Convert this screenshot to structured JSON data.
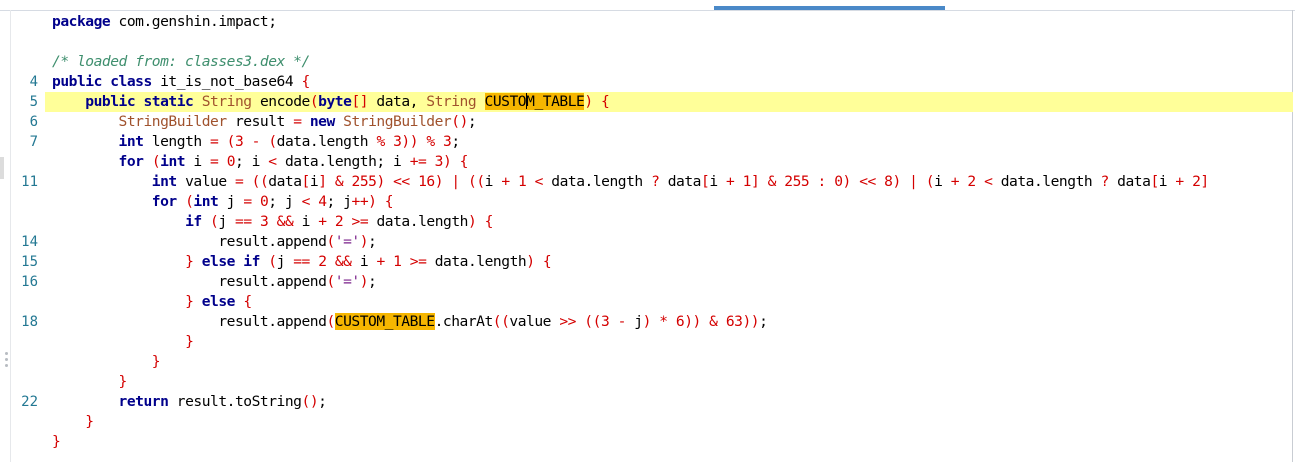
{
  "editor": {
    "lines": [
      {
        "num": "",
        "tokens": [
          [
            "kw",
            "package"
          ],
          [
            "pl",
            " com.genshin.impact;"
          ]
        ]
      },
      {
        "num": "",
        "tokens": []
      },
      {
        "num": "",
        "tokens": [
          [
            "cm",
            "/* loaded from: classes3.dex */"
          ]
        ]
      },
      {
        "num": "4",
        "tokens": [
          [
            "kw",
            "public class"
          ],
          [
            "pl",
            " it_is_not_base64 "
          ],
          [
            "pu",
            "{"
          ]
        ]
      },
      {
        "num": "5",
        "highlight": true,
        "tokens": [
          [
            "pl",
            "    "
          ],
          [
            "kw",
            "public static"
          ],
          [
            "pl",
            " "
          ],
          [
            "ty",
            "String"
          ],
          [
            "pl",
            " encode"
          ],
          [
            "pu",
            "("
          ],
          [
            "kw",
            "byte"
          ],
          [
            "pu",
            "[]"
          ],
          [
            "pl",
            " data, "
          ],
          [
            "ty",
            "String"
          ],
          [
            "pl",
            " "
          ],
          [
            "hl",
            "CUSTOM_TABLE",
            "caret",
            5
          ],
          [
            "pu",
            ")"
          ],
          [
            "pl",
            " "
          ],
          [
            "pu",
            "{"
          ]
        ]
      },
      {
        "num": "6",
        "tokens": [
          [
            "pl",
            "        "
          ],
          [
            "ty",
            "StringBuilder"
          ],
          [
            "pl",
            " result "
          ],
          [
            "pu",
            "="
          ],
          [
            "pl",
            " "
          ],
          [
            "kw",
            "new"
          ],
          [
            "pl",
            " "
          ],
          [
            "ty",
            "StringBuilder"
          ],
          [
            "pu",
            "()"
          ],
          [
            "pl",
            ";"
          ]
        ]
      },
      {
        "num": "7",
        "tokens": [
          [
            "pl",
            "        "
          ],
          [
            "kw",
            "int"
          ],
          [
            "pl",
            " length "
          ],
          [
            "pu",
            "="
          ],
          [
            "pl",
            " "
          ],
          [
            "pu",
            "("
          ],
          [
            "nu",
            "3"
          ],
          [
            "pl",
            " "
          ],
          [
            "pu",
            "-"
          ],
          [
            "pl",
            " "
          ],
          [
            "pu",
            "("
          ],
          [
            "pl",
            "data.length "
          ],
          [
            "pu",
            "%"
          ],
          [
            "pl",
            " "
          ],
          [
            "nu",
            "3"
          ],
          [
            "pu",
            "))"
          ],
          [
            "pl",
            " "
          ],
          [
            "pu",
            "%"
          ],
          [
            "pl",
            " "
          ],
          [
            "nu",
            "3"
          ],
          [
            "pl",
            ";"
          ]
        ]
      },
      {
        "num": "",
        "tokens": [
          [
            "pl",
            "        "
          ],
          [
            "kw",
            "for"
          ],
          [
            "pl",
            " "
          ],
          [
            "pu",
            "("
          ],
          [
            "kw",
            "int"
          ],
          [
            "pl",
            " i "
          ],
          [
            "pu",
            "="
          ],
          [
            "pl",
            " "
          ],
          [
            "nu",
            "0"
          ],
          [
            "pl",
            "; i "
          ],
          [
            "pu",
            "<"
          ],
          [
            "pl",
            " data.length; i "
          ],
          [
            "pu",
            "+="
          ],
          [
            "pl",
            " "
          ],
          [
            "nu",
            "3"
          ],
          [
            "pu",
            ")"
          ],
          [
            "pl",
            " "
          ],
          [
            "pu",
            "{"
          ]
        ]
      },
      {
        "num": "11",
        "tokens": [
          [
            "pl",
            "            "
          ],
          [
            "kw",
            "int"
          ],
          [
            "pl",
            " value "
          ],
          [
            "pu",
            "="
          ],
          [
            "pl",
            " "
          ],
          [
            "pu",
            "(("
          ],
          [
            "pl",
            "data"
          ],
          [
            "pu",
            "["
          ],
          [
            "pl",
            "i"
          ],
          [
            "pu",
            "]"
          ],
          [
            "pl",
            " "
          ],
          [
            "pu",
            "&"
          ],
          [
            "pl",
            " "
          ],
          [
            "nu",
            "255"
          ],
          [
            "pu",
            ")"
          ],
          [
            "pl",
            " "
          ],
          [
            "pu",
            "<<"
          ],
          [
            "pl",
            " "
          ],
          [
            "nu",
            "16"
          ],
          [
            "pu",
            ")"
          ],
          [
            "pl",
            " "
          ],
          [
            "pu",
            "|"
          ],
          [
            "pl",
            " "
          ],
          [
            "pu",
            "(("
          ],
          [
            "pl",
            "i "
          ],
          [
            "pu",
            "+"
          ],
          [
            "pl",
            " "
          ],
          [
            "nu",
            "1"
          ],
          [
            "pl",
            " "
          ],
          [
            "pu",
            "<"
          ],
          [
            "pl",
            " data.length "
          ],
          [
            "pu",
            "?"
          ],
          [
            "pl",
            " data"
          ],
          [
            "pu",
            "["
          ],
          [
            "pl",
            "i "
          ],
          [
            "pu",
            "+"
          ],
          [
            "pl",
            " "
          ],
          [
            "nu",
            "1"
          ],
          [
            "pu",
            "]"
          ],
          [
            "pl",
            " "
          ],
          [
            "pu",
            "&"
          ],
          [
            "pl",
            " "
          ],
          [
            "nu",
            "255"
          ],
          [
            "pl",
            " "
          ],
          [
            "pu",
            ":"
          ],
          [
            "pl",
            " "
          ],
          [
            "nu",
            "0"
          ],
          [
            "pu",
            ")"
          ],
          [
            "pl",
            " "
          ],
          [
            "pu",
            "<<"
          ],
          [
            "pl",
            " "
          ],
          [
            "nu",
            "8"
          ],
          [
            "pu",
            ")"
          ],
          [
            "pl",
            " "
          ],
          [
            "pu",
            "|"
          ],
          [
            "pl",
            " "
          ],
          [
            "pu",
            "("
          ],
          [
            "pl",
            "i "
          ],
          [
            "pu",
            "+"
          ],
          [
            "pl",
            " "
          ],
          [
            "nu",
            "2"
          ],
          [
            "pl",
            " "
          ],
          [
            "pu",
            "<"
          ],
          [
            "pl",
            " data.length "
          ],
          [
            "pu",
            "?"
          ],
          [
            "pl",
            " data"
          ],
          [
            "pu",
            "["
          ],
          [
            "pl",
            "i "
          ],
          [
            "pu",
            "+"
          ],
          [
            "pl",
            " "
          ],
          [
            "nu",
            "2"
          ],
          [
            "pu",
            "]"
          ]
        ]
      },
      {
        "num": "",
        "tokens": [
          [
            "pl",
            "            "
          ],
          [
            "kw",
            "for"
          ],
          [
            "pl",
            " "
          ],
          [
            "pu",
            "("
          ],
          [
            "kw",
            "int"
          ],
          [
            "pl",
            " j "
          ],
          [
            "pu",
            "="
          ],
          [
            "pl",
            " "
          ],
          [
            "nu",
            "0"
          ],
          [
            "pl",
            "; j "
          ],
          [
            "pu",
            "<"
          ],
          [
            "pl",
            " "
          ],
          [
            "nu",
            "4"
          ],
          [
            "pl",
            "; j"
          ],
          [
            "pu",
            "++)"
          ],
          [
            "pl",
            " "
          ],
          [
            "pu",
            "{"
          ]
        ]
      },
      {
        "num": "",
        "tokens": [
          [
            "pl",
            "                "
          ],
          [
            "kw",
            "if"
          ],
          [
            "pl",
            " "
          ],
          [
            "pu",
            "("
          ],
          [
            "pl",
            "j "
          ],
          [
            "pu",
            "=="
          ],
          [
            "pl",
            " "
          ],
          [
            "nu",
            "3"
          ],
          [
            "pl",
            " "
          ],
          [
            "pu",
            "&&"
          ],
          [
            "pl",
            " i "
          ],
          [
            "pu",
            "+"
          ],
          [
            "pl",
            " "
          ],
          [
            "nu",
            "2"
          ],
          [
            "pl",
            " "
          ],
          [
            "pu",
            ">="
          ],
          [
            "pl",
            " data.length"
          ],
          [
            "pu",
            ")"
          ],
          [
            "pl",
            " "
          ],
          [
            "pu",
            "{"
          ]
        ]
      },
      {
        "num": "14",
        "tokens": [
          [
            "pl",
            "                    result.append"
          ],
          [
            "pu",
            "("
          ],
          [
            "st",
            "'='"
          ],
          [
            "pu",
            ")"
          ],
          [
            "pl",
            ";"
          ]
        ]
      },
      {
        "num": "15",
        "tokens": [
          [
            "pl",
            "                "
          ],
          [
            "pu",
            "}"
          ],
          [
            "pl",
            " "
          ],
          [
            "kw",
            "else if"
          ],
          [
            "pl",
            " "
          ],
          [
            "pu",
            "("
          ],
          [
            "pl",
            "j "
          ],
          [
            "pu",
            "=="
          ],
          [
            "pl",
            " "
          ],
          [
            "nu",
            "2"
          ],
          [
            "pl",
            " "
          ],
          [
            "pu",
            "&&"
          ],
          [
            "pl",
            " i "
          ],
          [
            "pu",
            "+"
          ],
          [
            "pl",
            " "
          ],
          [
            "nu",
            "1"
          ],
          [
            "pl",
            " "
          ],
          [
            "pu",
            ">="
          ],
          [
            "pl",
            " data.length"
          ],
          [
            "pu",
            ")"
          ],
          [
            "pl",
            " "
          ],
          [
            "pu",
            "{"
          ]
        ]
      },
      {
        "num": "16",
        "tokens": [
          [
            "pl",
            "                    result.append"
          ],
          [
            "pu",
            "("
          ],
          [
            "st",
            "'='"
          ],
          [
            "pu",
            ")"
          ],
          [
            "pl",
            ";"
          ]
        ]
      },
      {
        "num": "",
        "tokens": [
          [
            "pl",
            "                "
          ],
          [
            "pu",
            "}"
          ],
          [
            "pl",
            " "
          ],
          [
            "kw",
            "else"
          ],
          [
            "pl",
            " "
          ],
          [
            "pu",
            "{"
          ]
        ]
      },
      {
        "num": "18",
        "tokens": [
          [
            "pl",
            "                    result.append"
          ],
          [
            "pu",
            "("
          ],
          [
            "hl",
            "CUSTOM_TABLE"
          ],
          [
            "pl",
            ".charAt"
          ],
          [
            "pu",
            "(("
          ],
          [
            "pl",
            "value "
          ],
          [
            "pu",
            ">>"
          ],
          [
            "pl",
            " "
          ],
          [
            "pu",
            "(("
          ],
          [
            "nu",
            "3"
          ],
          [
            "pl",
            " "
          ],
          [
            "pu",
            "-"
          ],
          [
            "pl",
            " j"
          ],
          [
            "pu",
            ")"
          ],
          [
            "pl",
            " "
          ],
          [
            "pu",
            "*"
          ],
          [
            "pl",
            " "
          ],
          [
            "nu",
            "6"
          ],
          [
            "pu",
            "))"
          ],
          [
            "pl",
            " "
          ],
          [
            "pu",
            "&"
          ],
          [
            "pl",
            " "
          ],
          [
            "nu",
            "63"
          ],
          [
            "pu",
            "))"
          ],
          [
            "pl",
            ";"
          ]
        ]
      },
      {
        "num": "",
        "tokens": [
          [
            "pl",
            "                "
          ],
          [
            "pu",
            "}"
          ]
        ]
      },
      {
        "num": "",
        "tokens": [
          [
            "pl",
            "            "
          ],
          [
            "pu",
            "}"
          ]
        ]
      },
      {
        "num": "",
        "tokens": [
          [
            "pl",
            "        "
          ],
          [
            "pu",
            "}"
          ]
        ]
      },
      {
        "num": "22",
        "tokens": [
          [
            "pl",
            "        "
          ],
          [
            "kw",
            "return"
          ],
          [
            "pl",
            " result.toString"
          ],
          [
            "pu",
            "()"
          ],
          [
            "pl",
            ";"
          ]
        ]
      },
      {
        "num": "",
        "tokens": [
          [
            "pl",
            "    "
          ],
          [
            "pu",
            "}"
          ]
        ]
      },
      {
        "num": "",
        "tokens": [
          [
            "pu",
            "}"
          ]
        ]
      }
    ]
  }
}
